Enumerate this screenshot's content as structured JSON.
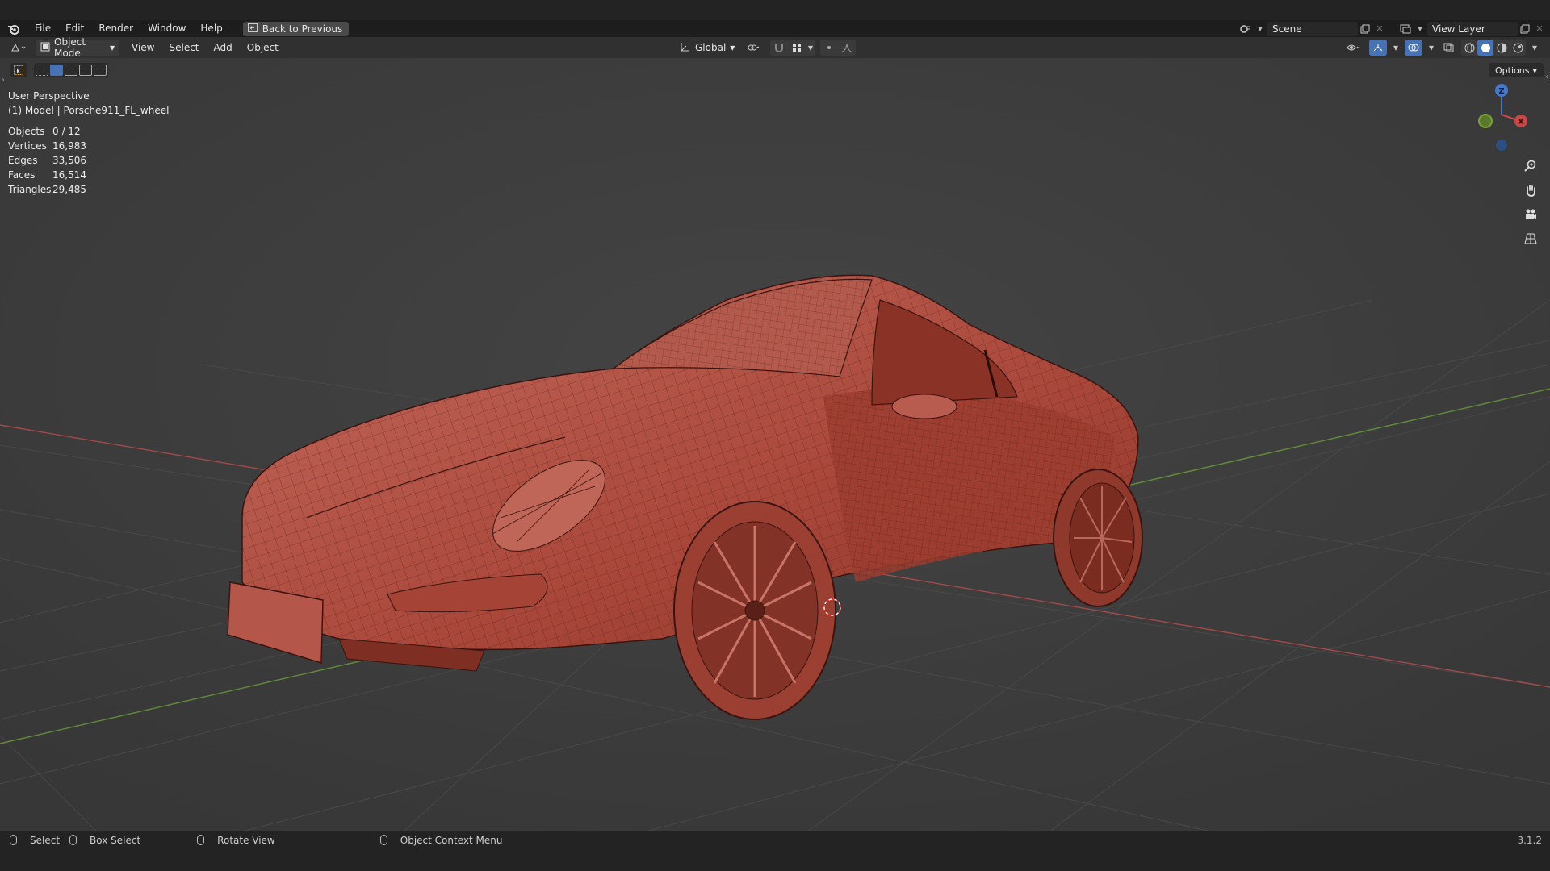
{
  "menu": {
    "items": [
      "File",
      "Edit",
      "Render",
      "Window",
      "Help"
    ],
    "back_button": "Back to Previous"
  },
  "topbar": {
    "scene": "Scene",
    "view_layer": "View Layer"
  },
  "viewport_header": {
    "mode": "Object Mode",
    "menus": [
      "View",
      "Select",
      "Add",
      "Object"
    ],
    "transform_orientation": "Global",
    "options": "Options"
  },
  "overlay": {
    "perspective": "User Perspective",
    "active_object": "(1) Model | Porsche911_FL_wheel"
  },
  "stats": [
    {
      "label": "Objects",
      "value": "0 / 12"
    },
    {
      "label": "Vertices",
      "value": "16,983"
    },
    {
      "label": "Edges",
      "value": "33,506"
    },
    {
      "label": "Faces",
      "value": "16,514"
    },
    {
      "label": "Triangles",
      "value": "29,485"
    }
  ],
  "gizmo": {
    "z": "Z",
    "x": "X"
  },
  "statusbar": {
    "select": "Select",
    "box_select": "Box Select",
    "rotate_view": "Rotate View",
    "context_menu": "Object Context Menu",
    "version": "3.1.2"
  },
  "colors": {
    "mesh": "#b5564a",
    "mesh_wire": "#3a1410",
    "x_axis": "#b34c4c",
    "y_axis": "#6a9c3a",
    "accent": "#4772b3"
  }
}
